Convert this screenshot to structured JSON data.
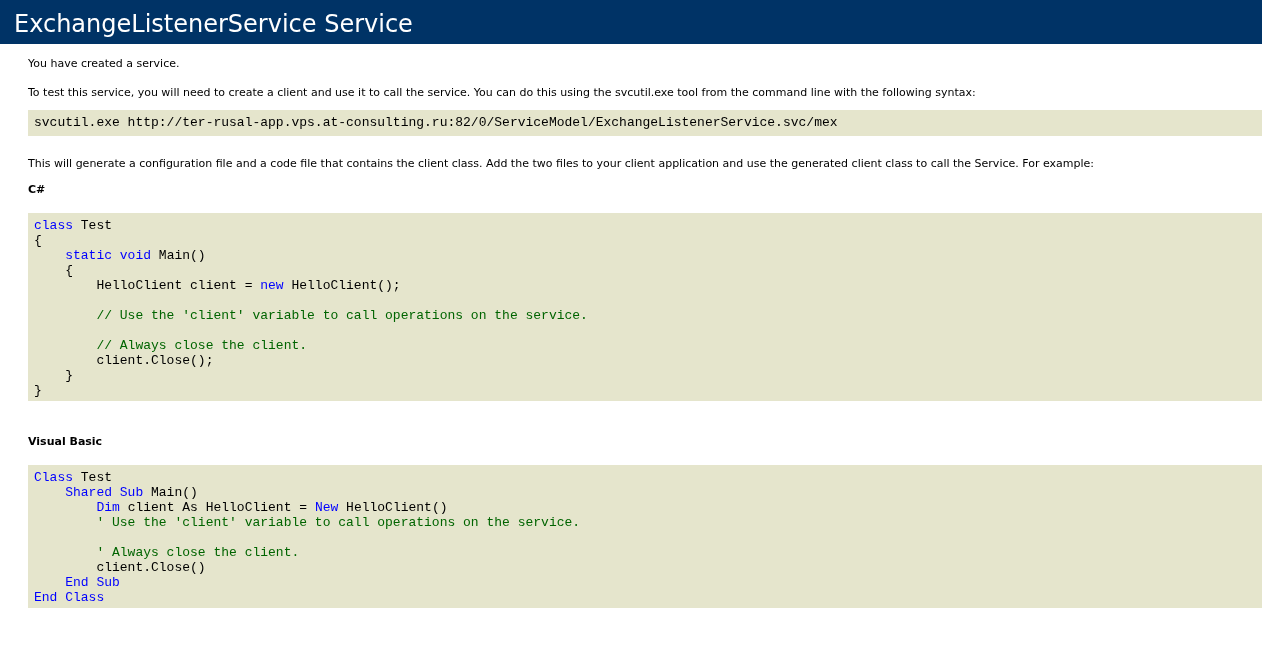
{
  "header": {
    "title": "ExchangeListenerService Service"
  },
  "content": [
    {
      "kind": "paragraph",
      "text": "You have created a service."
    },
    {
      "kind": "paragraph",
      "text": "To test this service, you will need to create a client and use it to call the service. You can do this using the svcutil.exe tool from the command line with the following syntax:"
    },
    {
      "kind": "command",
      "text": "svcutil.exe http://ter-rusal-app.vps.at-consulting.ru:82/0/ServiceModel/ExchangeListenerService.svc/mex"
    },
    {
      "kind": "paragraph",
      "text": "This will generate a configuration file and a code file that contains the client class. Add the two files to your client application and use the generated client class to call the Service. For example:"
    },
    {
      "kind": "heading",
      "text": "C#"
    },
    {
      "kind": "code",
      "lines": [
        {
          "kind": "code",
          "tokens": [
            {
              "kind": "keyword",
              "text": "class"
            },
            {
              "kind": "plain",
              "text": " Test"
            }
          ]
        },
        {
          "kind": "code",
          "tokens": [
            {
              "kind": "plain",
              "text": "{"
            }
          ]
        },
        {
          "kind": "code",
          "tokens": [
            {
              "kind": "keyword",
              "text": "    static void"
            },
            {
              "kind": "plain",
              "text": " Main()"
            }
          ]
        },
        {
          "kind": "code",
          "tokens": [
            {
              "kind": "plain",
              "text": "    {"
            }
          ]
        },
        {
          "kind": "code",
          "tokens": [
            {
              "kind": "plain",
              "text": "        HelloClient client = "
            },
            {
              "kind": "keyword",
              "text": "new"
            },
            {
              "kind": "plain",
              "text": " HelloClient();"
            }
          ]
        },
        {
          "kind": "blank"
        },
        {
          "kind": "code",
          "tokens": [
            {
              "kind": "comment",
              "text": "        // Use the 'client' variable to call operations on the service."
            }
          ]
        },
        {
          "kind": "blank"
        },
        {
          "kind": "code",
          "tokens": [
            {
              "kind": "comment",
              "text": "        // Always close the client."
            }
          ]
        },
        {
          "kind": "code",
          "tokens": [
            {
              "kind": "plain",
              "text": "        client.Close();"
            }
          ]
        },
        {
          "kind": "code",
          "tokens": [
            {
              "kind": "plain",
              "text": "    }"
            }
          ]
        },
        {
          "kind": "code",
          "tokens": [
            {
              "kind": "plain",
              "text": "}"
            }
          ]
        }
      ]
    },
    {
      "kind": "heading",
      "text": "Visual Basic"
    },
    {
      "kind": "code",
      "lines": [
        {
          "kind": "code",
          "tokens": [
            {
              "kind": "keyword",
              "text": "Class"
            },
            {
              "kind": "plain",
              "text": " Test"
            }
          ]
        },
        {
          "kind": "code",
          "tokens": [
            {
              "kind": "keyword",
              "text": "    Shared Sub"
            },
            {
              "kind": "plain",
              "text": " Main()"
            }
          ]
        },
        {
          "kind": "code",
          "tokens": [
            {
              "kind": "keyword",
              "text": "        Dim"
            },
            {
              "kind": "plain",
              "text": " client As HelloClient = "
            },
            {
              "kind": "keyword",
              "text": "New"
            },
            {
              "kind": "plain",
              "text": " HelloClient()"
            }
          ]
        },
        {
          "kind": "code",
          "tokens": [
            {
              "kind": "comment",
              "text": "        ' Use the 'client' variable to call operations on the service."
            }
          ]
        },
        {
          "kind": "blank"
        },
        {
          "kind": "code",
          "tokens": [
            {
              "kind": "comment",
              "text": "        ' Always close the client."
            }
          ]
        },
        {
          "kind": "code",
          "tokens": [
            {
              "kind": "plain",
              "text": "        client.Close()"
            }
          ]
        },
        {
          "kind": "code",
          "tokens": [
            {
              "kind": "keyword",
              "text": "    End Sub"
            }
          ]
        },
        {
          "kind": "code",
          "tokens": [
            {
              "kind": "keyword",
              "text": "End Class"
            }
          ]
        }
      ]
    }
  ]
}
